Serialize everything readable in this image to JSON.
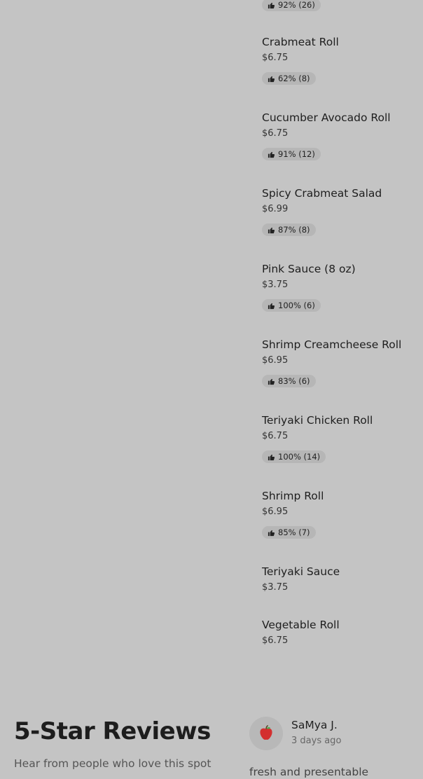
{
  "menu": {
    "top_badge": {
      "rating": "92% (26)"
    },
    "items": [
      {
        "name": "Crabmeat Roll",
        "price": "$6.75",
        "rating": "62% (8)"
      },
      {
        "name": "Cucumber Avocado Roll",
        "price": "$6.75",
        "rating": "91% (12)"
      },
      {
        "name": "Spicy Crabmeat Salad",
        "price": "$6.99",
        "rating": "87% (8)"
      },
      {
        "name": "Pink Sauce (8 oz)",
        "price": "$3.75",
        "rating": "100% (6)"
      },
      {
        "name": "Shrimp Creamcheese Roll",
        "price": "$6.95",
        "rating": "83% (6)"
      },
      {
        "name": "Teriyaki Chicken Roll",
        "price": "$6.75",
        "rating": "100% (14)"
      },
      {
        "name": "Shrimp Roll",
        "price": "$6.95",
        "rating": "85% (7)"
      },
      {
        "name": "Teriyaki Sauce",
        "price": "$3.75"
      },
      {
        "name": "Vegetable Roll",
        "price": "$6.75"
      }
    ]
  },
  "reviews": {
    "title": "5-Star Reviews",
    "subtitle": "Hear from people who love this spot",
    "review": {
      "avatar_icon": "apple-icon",
      "name": "SaMya J.",
      "time": "3 days ago",
      "text": "fresh and presentable"
    }
  },
  "colors": {
    "background": "#c4c4c4",
    "badge": "#b6b6b6",
    "avatar_apple": "#d32f2f"
  }
}
